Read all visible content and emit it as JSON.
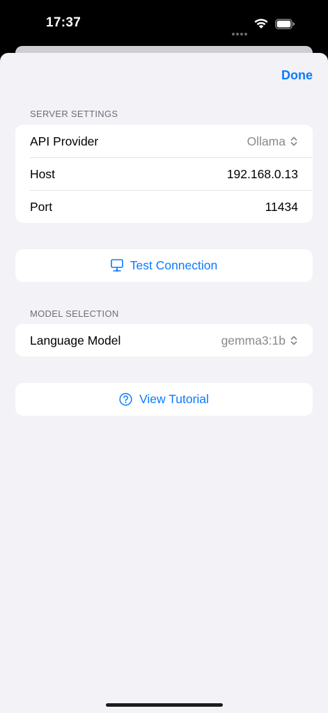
{
  "status_bar": {
    "time": "17:37"
  },
  "header": {
    "done_label": "Done"
  },
  "server_settings": {
    "header": "SERVER SETTINGS",
    "rows": [
      {
        "label": "API Provider",
        "value": "Ollama"
      },
      {
        "label": "Host",
        "value": "192.168.0.13"
      },
      {
        "label": "Port",
        "value": "11434"
      }
    ]
  },
  "test_connection": {
    "label": "Test Connection",
    "icon": "desktop-computer-icon"
  },
  "model_selection": {
    "header": "MODEL SELECTION",
    "rows": [
      {
        "label": "Language Model",
        "value": "gemma3:1b"
      }
    ]
  },
  "tutorial": {
    "label": "View Tutorial",
    "icon": "question-circle-icon"
  },
  "colors": {
    "accent": "#0a7aff",
    "background": "#f2f2f7",
    "secondary_text": "#8a8a8e"
  }
}
